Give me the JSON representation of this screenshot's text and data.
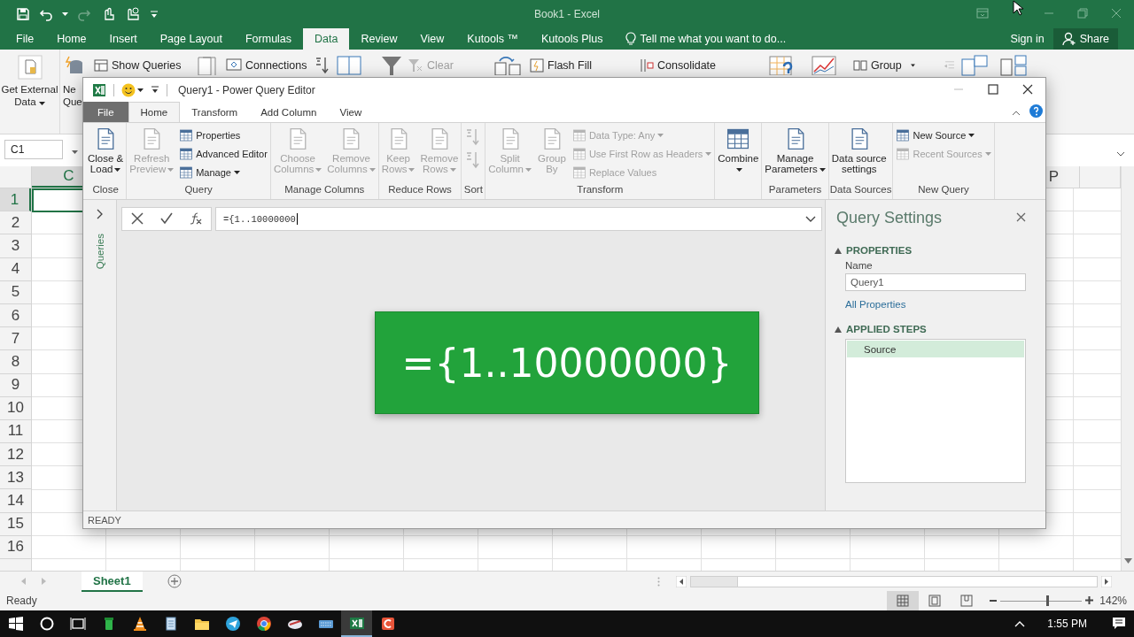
{
  "excel": {
    "title": "Book1 - Excel",
    "tabs": [
      {
        "label": "File",
        "selected": false
      },
      {
        "label": "Home",
        "selected": false
      },
      {
        "label": "Insert",
        "selected": false
      },
      {
        "label": "Page Layout",
        "selected": false
      },
      {
        "label": "Formulas",
        "selected": false
      },
      {
        "label": "Data",
        "selected": true
      },
      {
        "label": "Review",
        "selected": false
      },
      {
        "label": "View",
        "selected": false
      },
      {
        "label": "Kutools ™",
        "selected": false
      },
      {
        "label": "Kutools Plus",
        "selected": false
      }
    ],
    "tell_me": "Tell me what you want to do...",
    "sign_in": "Sign in",
    "share": "Share",
    "ribbon": {
      "get_external_data": "Get External\nData",
      "new_query": "Ne\nQue",
      "commands": [
        {
          "label": "Show Queries",
          "disabled": false
        },
        {
          "label": "Connections",
          "disabled": false
        },
        {
          "label": "Clear",
          "disabled": true
        },
        {
          "label": "Flash Fill",
          "disabled": false
        },
        {
          "label": "Consolidate",
          "disabled": false
        },
        {
          "label": "Group",
          "disabled": false
        }
      ]
    },
    "name_box": "C1",
    "column_headers": [
      "C",
      "P"
    ],
    "row_headers": [
      "1",
      "2",
      "3",
      "4",
      "5",
      "6",
      "7",
      "8",
      "9",
      "10",
      "11",
      "12",
      "13",
      "14",
      "15",
      "16"
    ],
    "sheet_tabs": [
      {
        "label": "Sheet1",
        "selected": true
      }
    ],
    "status": "Ready",
    "zoom": {
      "level": 0.58,
      "reading": "142%"
    }
  },
  "editor": {
    "title": "Query1 - Power Query Editor",
    "tabs": [
      {
        "label": "File",
        "selected": false
      },
      {
        "label": "Home",
        "selected": true
      },
      {
        "label": "Transform",
        "selected": false
      },
      {
        "label": "Add Column",
        "selected": false
      },
      {
        "label": "View",
        "selected": false
      }
    ],
    "ribbon_groups": [
      {
        "label": "Close",
        "items": [
          {
            "kind": "large",
            "label": "Close &\nLoad",
            "dropdown": true,
            "disabled": false
          }
        ]
      },
      {
        "label": "Query",
        "items": [
          {
            "kind": "large",
            "label": "Refresh\nPreview",
            "dropdown": true,
            "disabled": true
          },
          {
            "kind": "small",
            "label": "Properties",
            "dropdown": false,
            "disabled": false
          },
          {
            "kind": "small",
            "label": "Advanced Editor",
            "dropdown": false,
            "disabled": false
          },
          {
            "kind": "small",
            "label": "Manage",
            "dropdown": true,
            "disabled": false
          }
        ]
      },
      {
        "label": "Manage Columns",
        "items": [
          {
            "kind": "large",
            "label": "Choose\nColumns",
            "dropdown": true,
            "disabled": true
          },
          {
            "kind": "large",
            "label": "Remove\nColumns",
            "dropdown": true,
            "disabled": true
          }
        ]
      },
      {
        "label": "Reduce Rows",
        "items": [
          {
            "kind": "large",
            "label": "Keep\nRows",
            "dropdown": true,
            "disabled": true
          },
          {
            "kind": "large",
            "label": "Remove\nRows",
            "dropdown": true,
            "disabled": true
          }
        ]
      },
      {
        "label": "Sort",
        "items": [
          {
            "kind": "icon",
            "disabled": true
          },
          {
            "kind": "icon",
            "disabled": true
          }
        ]
      },
      {
        "label": "Transform",
        "items": [
          {
            "kind": "large",
            "label": "Split\nColumn",
            "dropdown": true,
            "disabled": true
          },
          {
            "kind": "large",
            "label": "Group\nBy",
            "dropdown": false,
            "disabled": true
          },
          {
            "kind": "small",
            "label": "Data Type: Any",
            "dropdown": true,
            "disabled": true
          },
          {
            "kind": "small",
            "label": "Use First Row as Headers",
            "dropdown": true,
            "disabled": true
          },
          {
            "kind": "small",
            "label": "Replace Values",
            "dropdown": false,
            "disabled": true
          }
        ]
      },
      {
        "items": [
          {
            "kind": "large",
            "label": "Combine",
            "dropdown": true,
            "disabled": false
          }
        ]
      },
      {
        "label": "Parameters",
        "items": [
          {
            "kind": "large",
            "label": "Manage\nParameters",
            "dropdown": true,
            "disabled": false
          }
        ]
      },
      {
        "label": "Data Sources",
        "items": [
          {
            "kind": "large",
            "label": "Data source\nsettings",
            "dropdown": false,
            "disabled": false
          }
        ]
      },
      {
        "label": "New Query",
        "items": [
          {
            "kind": "small",
            "label": "New Source",
            "dropdown": true,
            "disabled": false
          },
          {
            "kind": "small",
            "label": "Recent Sources",
            "dropdown": true,
            "disabled": true
          }
        ]
      }
    ],
    "queries_pane": {
      "label": "Queries",
      "expanded": false
    },
    "formula": "={1..10000000",
    "settings": {
      "title": "Query Settings",
      "properties": {
        "heading": "PROPERTIES",
        "expanded": true,
        "name_label": "Name",
        "name_value": "Query1",
        "all_properties": "All Properties"
      },
      "applied_steps": {
        "heading": "APPLIED STEPS",
        "expanded": true,
        "steps": [
          {
            "label": "Source",
            "selected": true
          }
        ]
      }
    },
    "status": "READY"
  },
  "callout": "={1..10000000}",
  "taskbar": {
    "apps": [
      {
        "selected": false
      },
      {
        "selected": false
      },
      {
        "selected": false
      },
      {
        "selected": false
      },
      {
        "selected": false
      },
      {
        "selected": false
      },
      {
        "selected": false
      },
      {
        "selected": false
      },
      {
        "selected": true
      },
      {
        "selected": false
      }
    ],
    "time": "1:55 PM"
  }
}
